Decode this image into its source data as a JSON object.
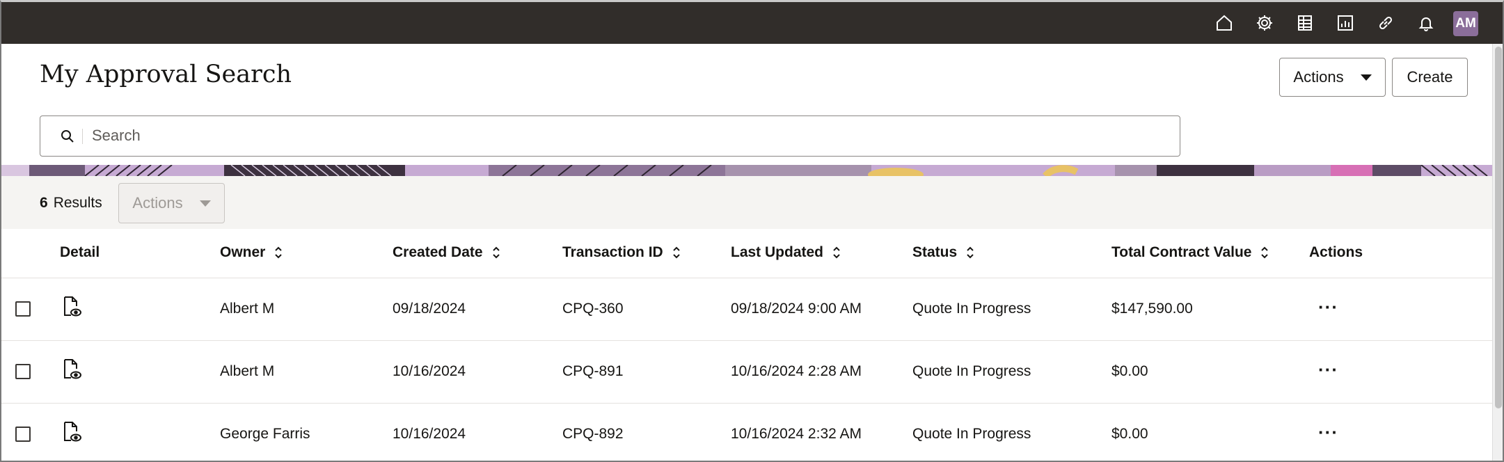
{
  "header": {
    "icons": [
      "home-icon",
      "settings-icon",
      "report-table-icon",
      "bar-chart-icon",
      "link-icon",
      "notifications-icon"
    ],
    "avatar_initials": "AM",
    "avatar_color": "#8b6e9a",
    "bar_color": "#312d2a"
  },
  "page": {
    "title": "My Approval Search",
    "actions_label": "Actions",
    "create_label": "Create"
  },
  "search": {
    "placeholder": "Search"
  },
  "results": {
    "count": "6",
    "label": "Results",
    "actions_label": "Actions"
  },
  "table": {
    "columns": {
      "detail": "Detail",
      "owner": "Owner",
      "created": "Created Date",
      "transaction": "Transaction ID",
      "updated": "Last Updated",
      "status": "Status",
      "value": "Total Contract Value",
      "actions": "Actions"
    },
    "rows": [
      {
        "owner": "Albert M",
        "created": "09/18/2024",
        "transaction": "CPQ-360",
        "updated": "09/18/2024 9:00 AM",
        "status": "Quote In Progress",
        "value": "$147,590.00",
        "more": "···"
      },
      {
        "owner": "Albert M",
        "created": "10/16/2024",
        "transaction": "CPQ-891",
        "updated": "10/16/2024 2:28 AM",
        "status": "Quote In Progress",
        "value": "$0.00",
        "more": "···"
      },
      {
        "owner": "George Farris",
        "created": "10/16/2024",
        "transaction": "CPQ-892",
        "updated": "10/16/2024 2:32 AM",
        "status": "Quote In Progress",
        "value": "$0.00",
        "more": "···"
      }
    ]
  }
}
